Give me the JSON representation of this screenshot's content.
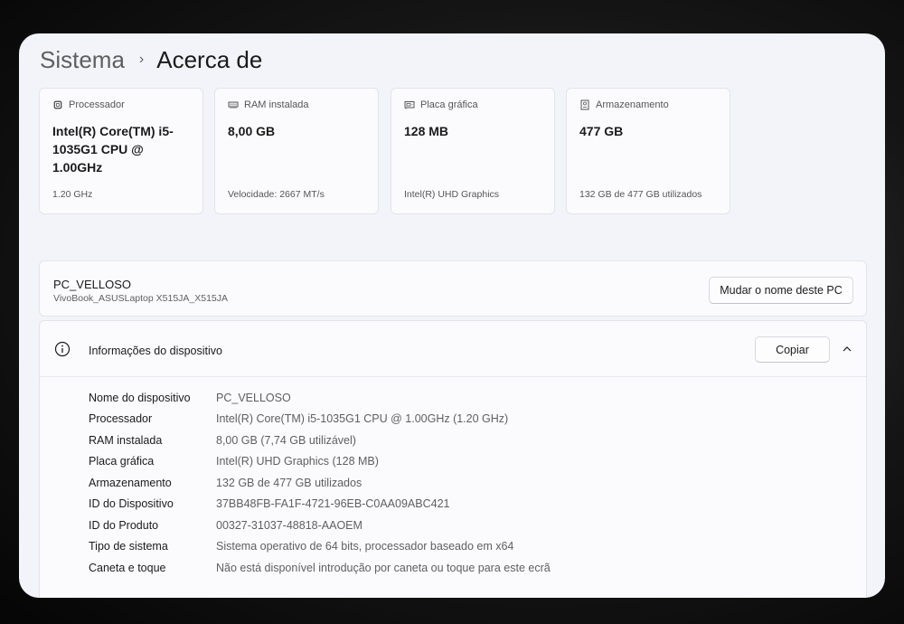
{
  "breadcrumb": {
    "parent": "Sistema",
    "separator": "›",
    "current": "Acerca de"
  },
  "cards": [
    {
      "icon": "processor-icon",
      "label": "Processador",
      "value": "Intel(R) Core(TM) i5-1035G1 CPU @ 1.00GHz",
      "sub": "1.20 GHz"
    },
    {
      "icon": "ram-icon",
      "label": "RAM instalada",
      "value": "8,00 GB",
      "sub": "Velocidade: 2667 MT/s"
    },
    {
      "icon": "graphics-card-icon",
      "label": "Placa gráfica",
      "value": "128 MB",
      "sub": "Intel(R) UHD Graphics"
    },
    {
      "icon": "storage-icon",
      "label": "Armazenamento",
      "value": "477 GB",
      "sub": "132 GB de 477 GB utilizados"
    }
  ],
  "pc": {
    "name": "PC_VELLOSO",
    "model": "VivoBook_ASUSLaptop X515JA_X515JA",
    "rename_label": "Mudar o nome deste PC"
  },
  "device_info": {
    "title": "Informações do dispositivo",
    "copy_label": "Copiar",
    "specs": [
      {
        "key": "Nome do dispositivo",
        "value": "PC_VELLOSO"
      },
      {
        "key": "Processador",
        "value": "Intel(R) Core(TM) i5-1035G1 CPU @ 1.00GHz (1.20 GHz)"
      },
      {
        "key": "RAM instalada",
        "value": "8,00 GB (7,74 GB utilizável)"
      },
      {
        "key": "Placa gráfica",
        "value": "Intel(R) UHD Graphics (128 MB)"
      },
      {
        "key": "Armazenamento",
        "value": "132 GB de 477 GB utilizados"
      },
      {
        "key": "ID do Dispositivo",
        "value": "37BB48FB-FA1F-4721-96EB-C0AA09ABC421"
      },
      {
        "key": "ID do Produto",
        "value": "00327-31037-48818-AAOEM"
      },
      {
        "key": "Tipo de sistema",
        "value": "Sistema operativo de 64 bits, processador baseado em x64"
      },
      {
        "key": "Caneta e toque",
        "value": "Não está disponível introdução por caneta ou toque para este ecrã"
      }
    ]
  }
}
